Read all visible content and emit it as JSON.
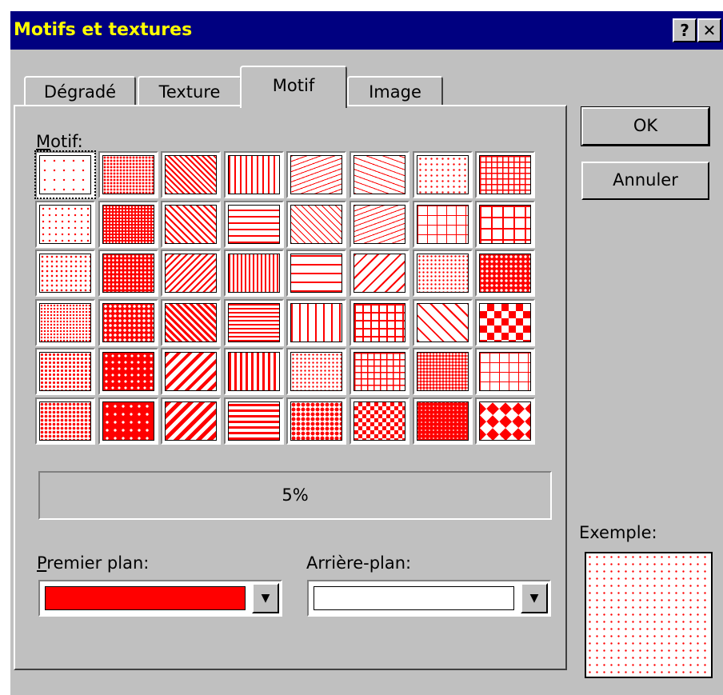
{
  "dialog": {
    "title": "Motifs et textures",
    "help_button": "?",
    "close_button": "✕"
  },
  "tabs": [
    {
      "label": "Dégradé",
      "active": false
    },
    {
      "label": "Texture",
      "active": false
    },
    {
      "label": "Motif",
      "active": true
    },
    {
      "label": "Image",
      "active": false
    }
  ],
  "motif": {
    "label": "Motif:",
    "selected_name": "5%",
    "selected_index": 0,
    "pattern_color": "#ff0000",
    "pattern_count": 48
  },
  "premier_plan": {
    "label": "Premier plan:",
    "color": "#ff0000"
  },
  "arriere_plan": {
    "label": "Arrière-plan:",
    "color": "#ffffff"
  },
  "buttons": {
    "ok": "OK",
    "cancel": "Annuler"
  },
  "example": {
    "label": "Exemple:"
  }
}
